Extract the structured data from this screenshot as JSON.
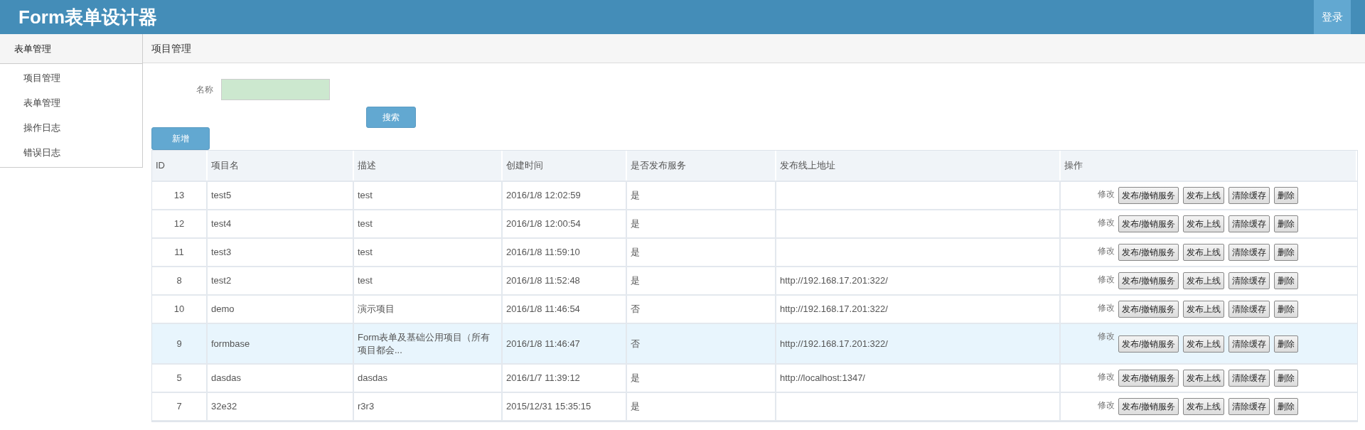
{
  "header": {
    "title": "Form表单设计器",
    "login": "登录"
  },
  "sidebar": {
    "title": "表单管理",
    "items": [
      {
        "label": "项目管理"
      },
      {
        "label": "表单管理"
      },
      {
        "label": "操作日志"
      },
      {
        "label": "错误日志"
      }
    ]
  },
  "panel": {
    "title": "项目管理"
  },
  "search": {
    "label": "名称",
    "button": "搜索"
  },
  "add_button": "新增",
  "table": {
    "columns": [
      "ID",
      "项目名",
      "描述",
      "创建时间",
      "是否发布服务",
      "发布线上地址",
      "操作"
    ],
    "rows": [
      {
        "id": "13",
        "name": "test5",
        "desc": "test",
        "created": "2016/1/8 12:02:59",
        "published": "是",
        "url": "",
        "selected": false,
        "edit": "修改",
        "buttons": [
          "发布/撤销服务",
          "发布上线",
          "清除缓存",
          "删除"
        ]
      },
      {
        "id": "12",
        "name": "test4",
        "desc": "test",
        "created": "2016/1/8 12:00:54",
        "published": "是",
        "url": "",
        "selected": false,
        "edit": "修改",
        "buttons": [
          "发布/撤销服务",
          "发布上线",
          "清除缓存",
          "删除"
        ]
      },
      {
        "id": "11",
        "name": "test3",
        "desc": "test",
        "created": "2016/1/8 11:59:10",
        "published": "是",
        "url": "",
        "selected": false,
        "edit": "修改",
        "buttons": [
          "发布/撤销服务",
          "发布上线",
          "清除缓存",
          "删除"
        ]
      },
      {
        "id": "8",
        "name": "test2",
        "desc": "test",
        "created": "2016/1/8 11:52:48",
        "published": "是",
        "url": "http://192.168.17.201:322/",
        "selected": false,
        "edit": "修改",
        "buttons": [
          "发布/撤销服务",
          "发布上线",
          "清除缓存",
          "删除"
        ]
      },
      {
        "id": "10",
        "name": "demo",
        "desc": "演示项目",
        "created": "2016/1/8 11:46:54",
        "published": "否",
        "url": "http://192.168.17.201:322/",
        "selected": false,
        "edit": "修改",
        "buttons": [
          "发布/撤销服务",
          "发布上线",
          "清除缓存",
          "删除"
        ]
      },
      {
        "id": "9",
        "name": "formbase",
        "desc": "Form表单及基础公用项目（所有项目都会...",
        "created": "2016/1/8 11:46:47",
        "published": "否",
        "url": "http://192.168.17.201:322/",
        "selected": true,
        "edit": "修改",
        "buttons": [
          "发布/撤销服务",
          "发布上线",
          "清除缓存",
          "删除"
        ]
      },
      {
        "id": "5",
        "name": "dasdas",
        "desc": "dasdas",
        "created": "2016/1/7 11:39:12",
        "published": "是",
        "url": "http://localhost:1347/",
        "selected": false,
        "edit": "修改",
        "buttons": [
          "发布/撤销服务",
          "发布上线",
          "清除缓存",
          "删除"
        ]
      },
      {
        "id": "7",
        "name": "32e32",
        "desc": "r3r3",
        "created": "2015/12/31 15:35:15",
        "published": "是",
        "url": "",
        "selected": false,
        "edit": "修改",
        "buttons": [
          "发布/撤销服务",
          "发布上线",
          "清除缓存",
          "删除"
        ]
      }
    ]
  }
}
